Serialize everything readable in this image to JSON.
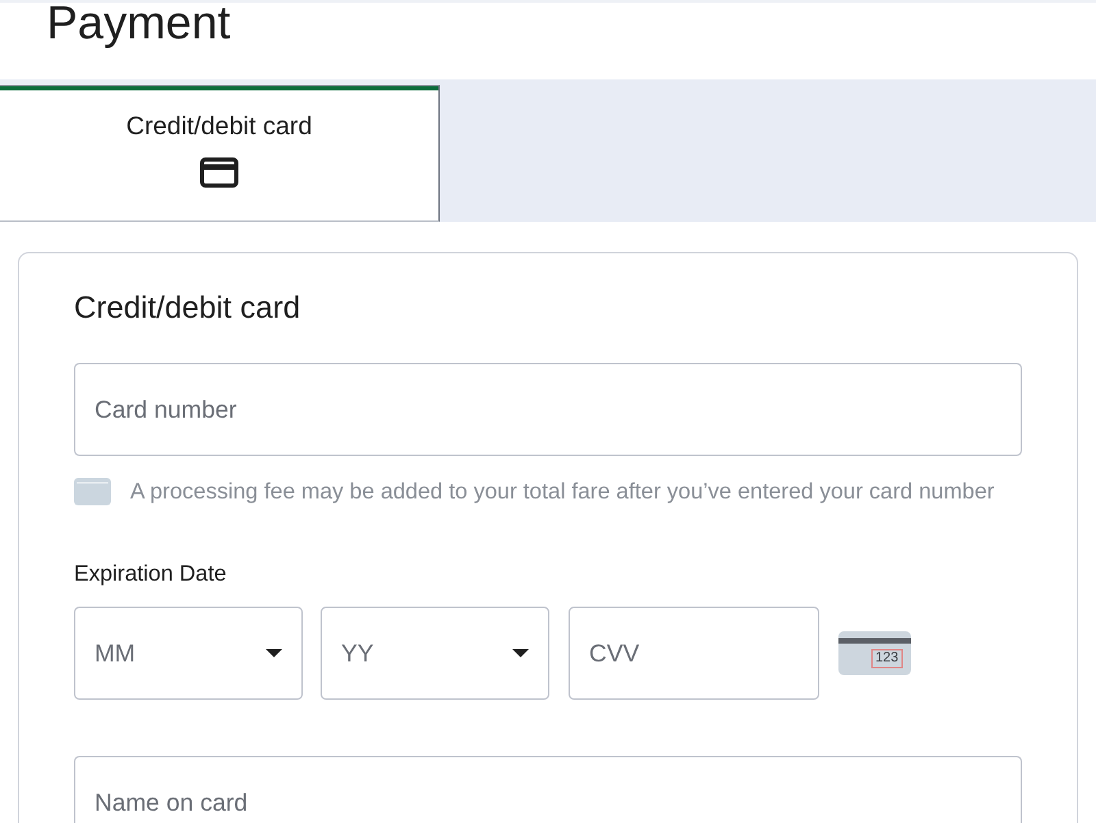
{
  "page": {
    "title": "Payment"
  },
  "tabs": [
    {
      "label": "Credit/debit card",
      "selected": true
    }
  ],
  "card_form": {
    "heading": "Credit/debit card",
    "card_number": {
      "placeholder": "Card number"
    },
    "fee_note": "A processing fee may be added to your total fare after you’ve entered your card number",
    "expiration_label": "Expiration Date",
    "month": {
      "placeholder": "MM"
    },
    "year": {
      "placeholder": "YY"
    },
    "cvv": {
      "placeholder": "CVV"
    },
    "cvv_example": "123",
    "name_on_card": {
      "placeholder": "Name on card"
    }
  }
}
